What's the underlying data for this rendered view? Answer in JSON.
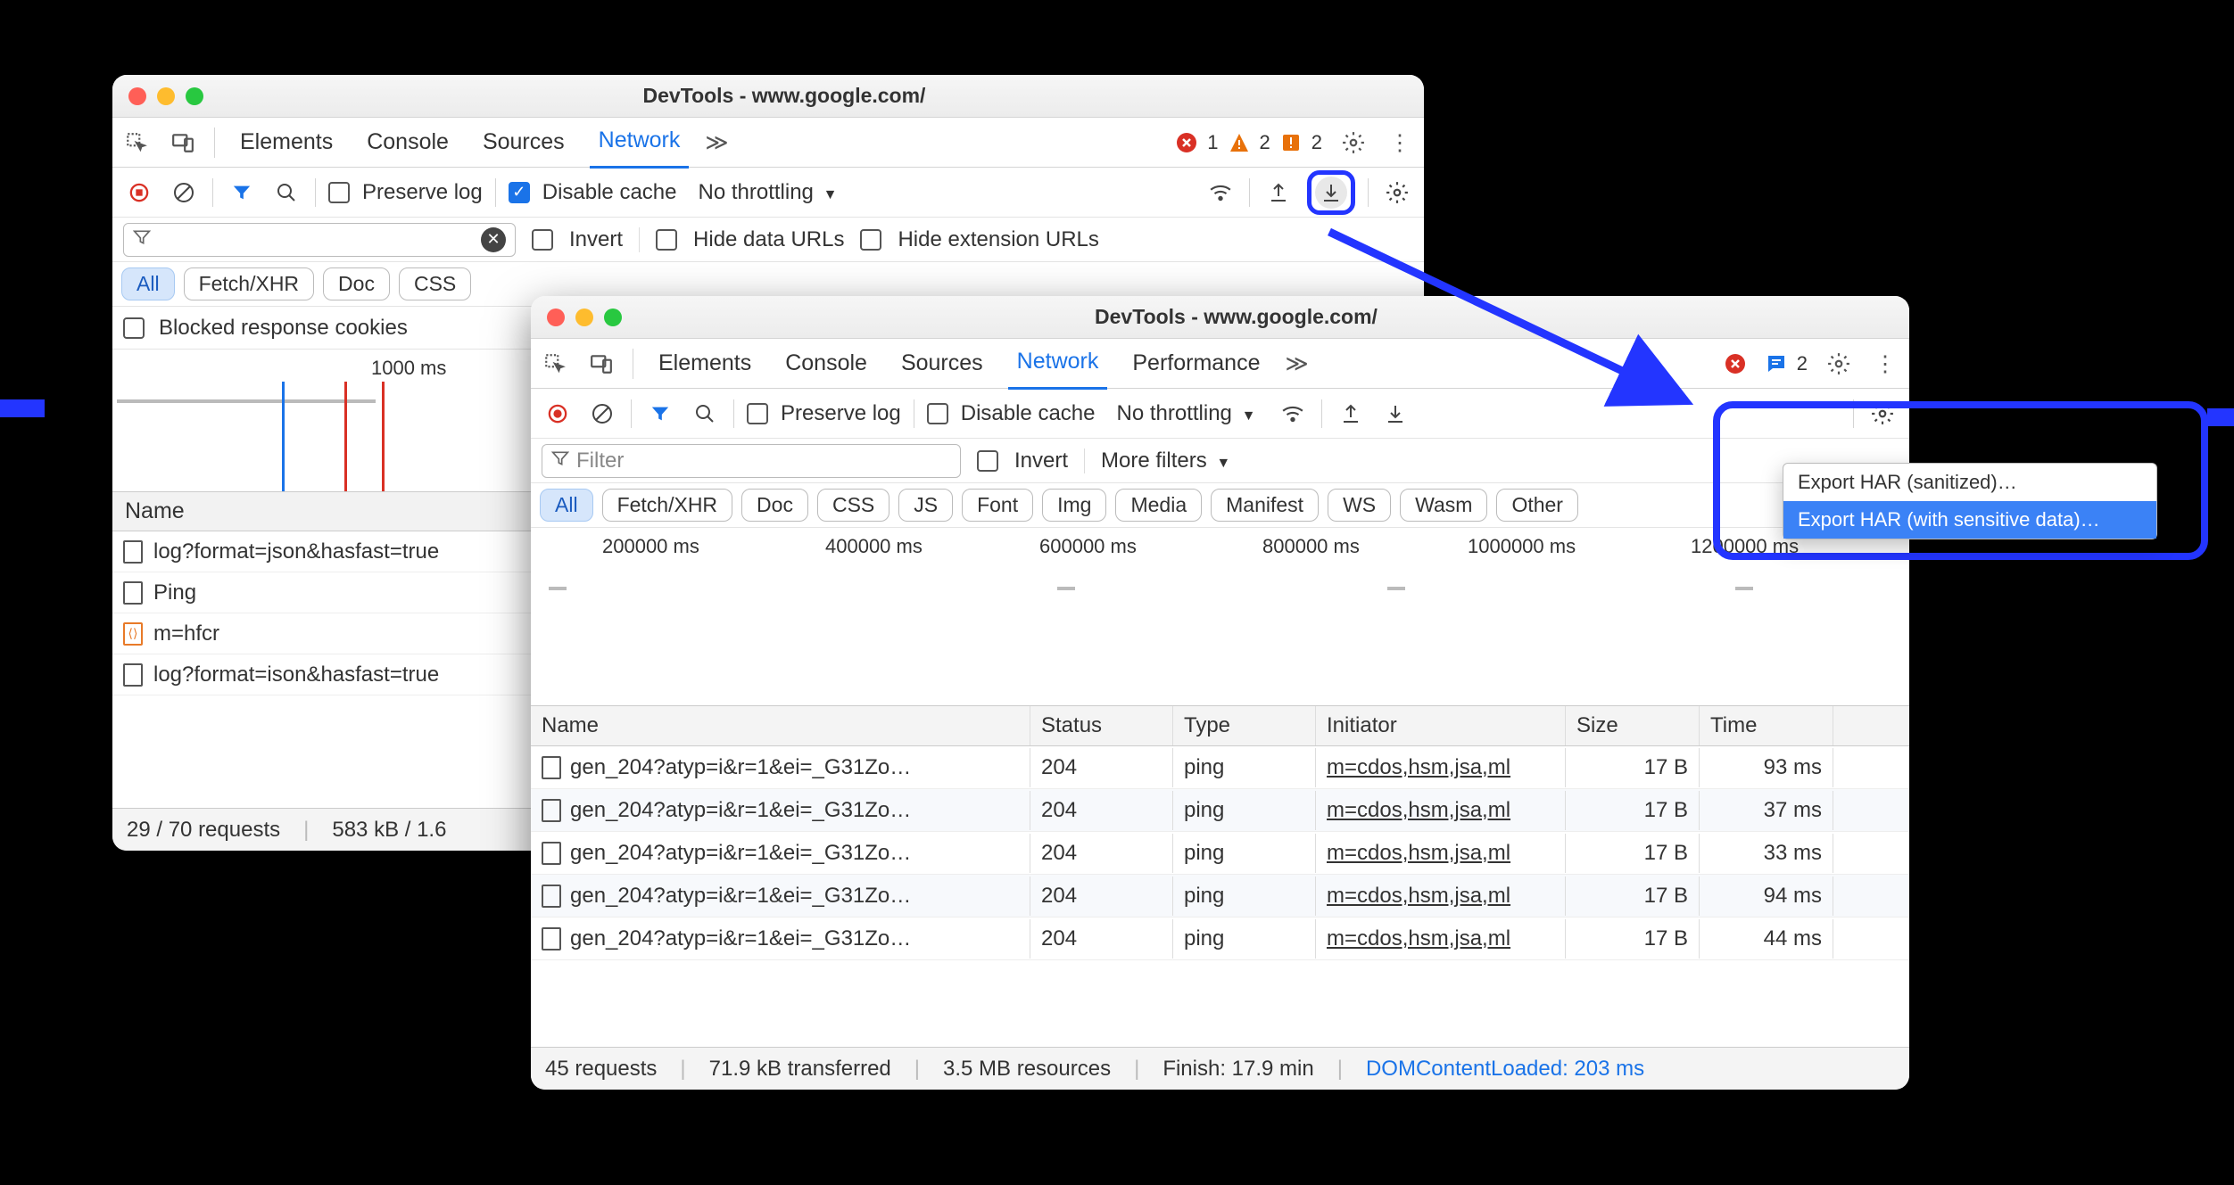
{
  "win1": {
    "title": "DevTools - www.google.com/",
    "tabs": [
      "Elements",
      "Console",
      "Sources",
      "Network"
    ],
    "activeTab": "Network",
    "badges": {
      "errors": "1",
      "warnings": "2",
      "issues": "2"
    },
    "toolbar": {
      "preserve": "Preserve log",
      "disable": "Disable cache",
      "throttling": "No throttling"
    },
    "filterbar": {
      "invert": "Invert",
      "hideData": "Hide data URLs",
      "hideExt": "Hide extension URLs"
    },
    "pills": [
      "All",
      "Fetch/XHR",
      "Doc",
      "CSS"
    ],
    "rowOpt": {
      "blocked": "Blocked response cookies"
    },
    "timeline": {
      "tick1": "1000 ms"
    },
    "nameHeader": "Name",
    "rows": [
      {
        "text": "log?format=json&hasfast=true"
      },
      {
        "text": "Ping"
      },
      {
        "text": "m=hfcr",
        "orange": true
      },
      {
        "text": "log?format=ison&hasfast=true"
      }
    ],
    "footer": {
      "requests": "29 / 70 requests",
      "size": "583 kB / 1.6"
    }
  },
  "win2": {
    "title": "DevTools - www.google.com/",
    "tabs": [
      "Elements",
      "Console",
      "Sources",
      "Network",
      "Performance"
    ],
    "activeTab": "Network",
    "badges": {
      "issues": "2"
    },
    "toolbar": {
      "preserve": "Preserve log",
      "disable": "Disable cache",
      "throttling": "No throttling"
    },
    "filterbar": {
      "placeholder": "Filter",
      "invert": "Invert",
      "more": "More filters"
    },
    "pills": [
      "All",
      "Fetch/XHR",
      "Doc",
      "CSS",
      "JS",
      "Font",
      "Img",
      "Media",
      "Manifest",
      "WS",
      "Wasm",
      "Other"
    ],
    "timeline": {
      "t1": "200000 ms",
      "t2": "400000 ms",
      "t3": "600000 ms",
      "t4": "800000 ms",
      "t5": "1000000 ms",
      "t6": "1200000 ms"
    },
    "headers": {
      "name": "Name",
      "status": "Status",
      "type": "Type",
      "init": "Initiator",
      "size": "Size",
      "time": "Time"
    },
    "rows": [
      {
        "name": "gen_204?atyp=i&r=1&ei=_G31Zo…",
        "status": "204",
        "type": "ping",
        "init": "m=cdos,hsm,jsa,ml",
        "size": "17 B",
        "time": "93 ms"
      },
      {
        "name": "gen_204?atyp=i&r=1&ei=_G31Zo…",
        "status": "204",
        "type": "ping",
        "init": "m=cdos,hsm,jsa,ml",
        "size": "17 B",
        "time": "37 ms"
      },
      {
        "name": "gen_204?atyp=i&r=1&ei=_G31Zo…",
        "status": "204",
        "type": "ping",
        "init": "m=cdos,hsm,jsa,ml",
        "size": "17 B",
        "time": "33 ms"
      },
      {
        "name": "gen_204?atyp=i&r=1&ei=_G31Zo…",
        "status": "204",
        "type": "ping",
        "init": "m=cdos,hsm,jsa,ml",
        "size": "17 B",
        "time": "94 ms"
      },
      {
        "name": "gen_204?atyp=i&r=1&ei=_G31Zo…",
        "status": "204",
        "type": "ping",
        "init": "m=cdos,hsm,jsa,ml",
        "size": "17 B",
        "time": "44 ms"
      }
    ],
    "footer": {
      "req": "45 requests",
      "trans": "71.9 kB transferred",
      "res": "3.5 MB resources",
      "finish": "Finish: 17.9 min",
      "dcl": "DOMContentLoaded: 203 ms"
    },
    "menu": {
      "opt1": "Export HAR (sanitized)…",
      "opt2": "Export HAR (with sensitive data)…"
    }
  }
}
